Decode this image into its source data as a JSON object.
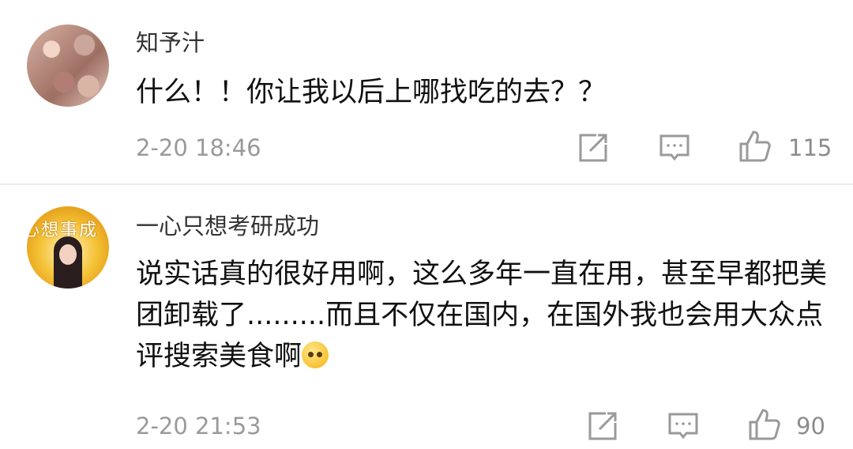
{
  "comments": [
    {
      "username": "知予汁",
      "text": "什么！！你让我以后上哪找吃的去？？",
      "time": "2-20 18:46",
      "likes": "115",
      "icons": {
        "share": "share-square-arrow-icon",
        "reply": "comment-bubble-icon",
        "like": "thumbs-up-icon"
      }
    },
    {
      "username": "一心只想考研成功",
      "avatar_text": "心想事成",
      "text": "说实话真的很好用啊，这么多年一直在用，甚至早都把美团卸载了.........而且不仅在国内，在国外我也会用大众点评搜索美食啊",
      "time": "2-20 21:53",
      "likes": "90",
      "icons": {
        "share": "share-square-arrow-icon",
        "reply": "comment-bubble-icon",
        "like": "thumbs-up-icon"
      }
    }
  ],
  "colors": {
    "username": "#333333",
    "body_text": "#111111",
    "meta": "#9a9a9a",
    "divider": "#ececec"
  }
}
